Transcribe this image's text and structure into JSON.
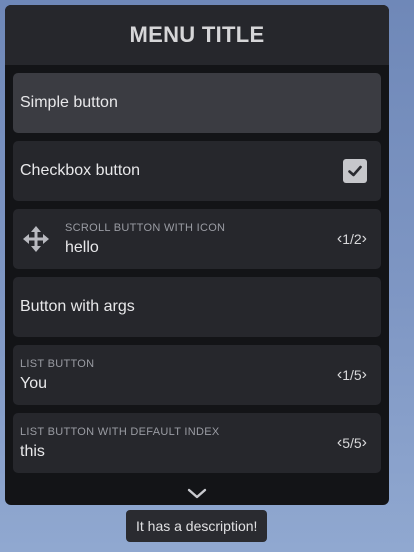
{
  "menu": {
    "title": "MENU TITLE",
    "items": [
      {
        "type": "button",
        "label": "Simple button",
        "selected": true
      },
      {
        "type": "checkbox",
        "label": "Checkbox button",
        "checked": true,
        "icon": "check-icon"
      },
      {
        "type": "scroll",
        "label": "SCROLL BUTTON WITH ICON",
        "value": "hello",
        "counter": "1/2",
        "icon": "move-icon"
      },
      {
        "type": "button",
        "label": "Button with args"
      },
      {
        "type": "list",
        "label": "LIST BUTTON",
        "value": "You",
        "counter": "1/5"
      },
      {
        "type": "list",
        "label": "LIST BUTTON WITH DEFAULT INDEX",
        "value": "this",
        "counter": "5/5"
      }
    ],
    "scroll_icon": "chevron-down-icon"
  },
  "tooltip": {
    "text": "It has a description!"
  },
  "colors": {
    "panel": "#131417",
    "header": "#26272c",
    "item": "#26272c",
    "selected": "#3b3c42",
    "checkbox": "#c6c7cb"
  }
}
